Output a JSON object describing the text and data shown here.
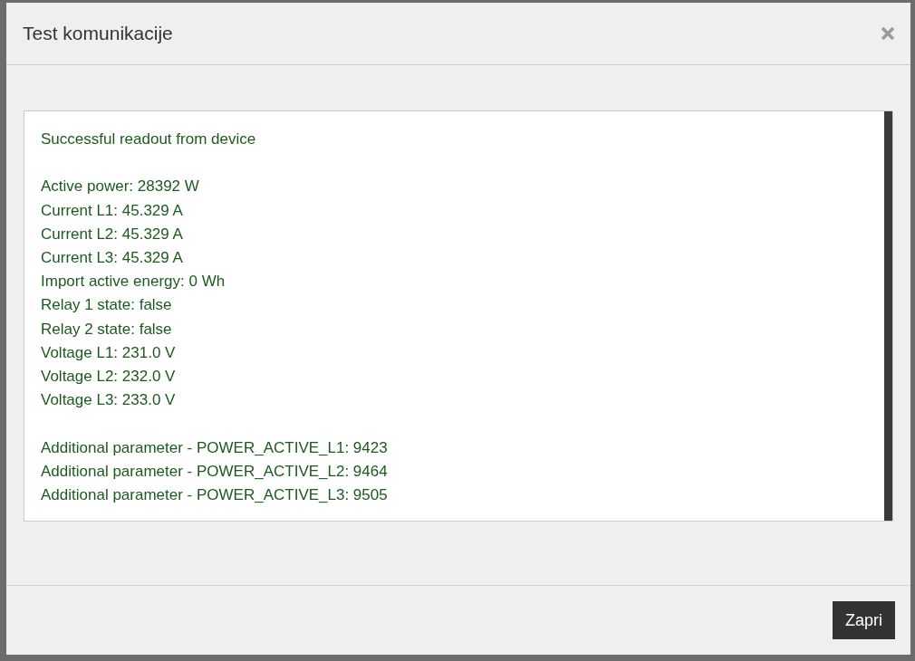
{
  "dialog": {
    "title": "Test komunikacije"
  },
  "readout": {
    "sections": [
      {
        "lines": [
          "Successful readout from device"
        ]
      },
      {
        "lines": [
          "Active power: 28392 W",
          "Current L1: 45.329 A",
          "Current L2: 45.329 A",
          "Current L3: 45.329 A",
          "Import active energy: 0 Wh",
          "Relay 1 state: false",
          "Relay 2 state: false",
          "Voltage L1: 231.0 V",
          "Voltage L2: 232.0 V",
          "Voltage L3: 233.0 V"
        ]
      },
      {
        "lines": [
          "Additional parameter - POWER_ACTIVE_L1: 9423",
          "Additional parameter - POWER_ACTIVE_L2: 9464",
          "Additional parameter - POWER_ACTIVE_L3: 9505"
        ]
      }
    ]
  },
  "footer": {
    "buttons": [
      {
        "label": "Zapri"
      }
    ]
  }
}
